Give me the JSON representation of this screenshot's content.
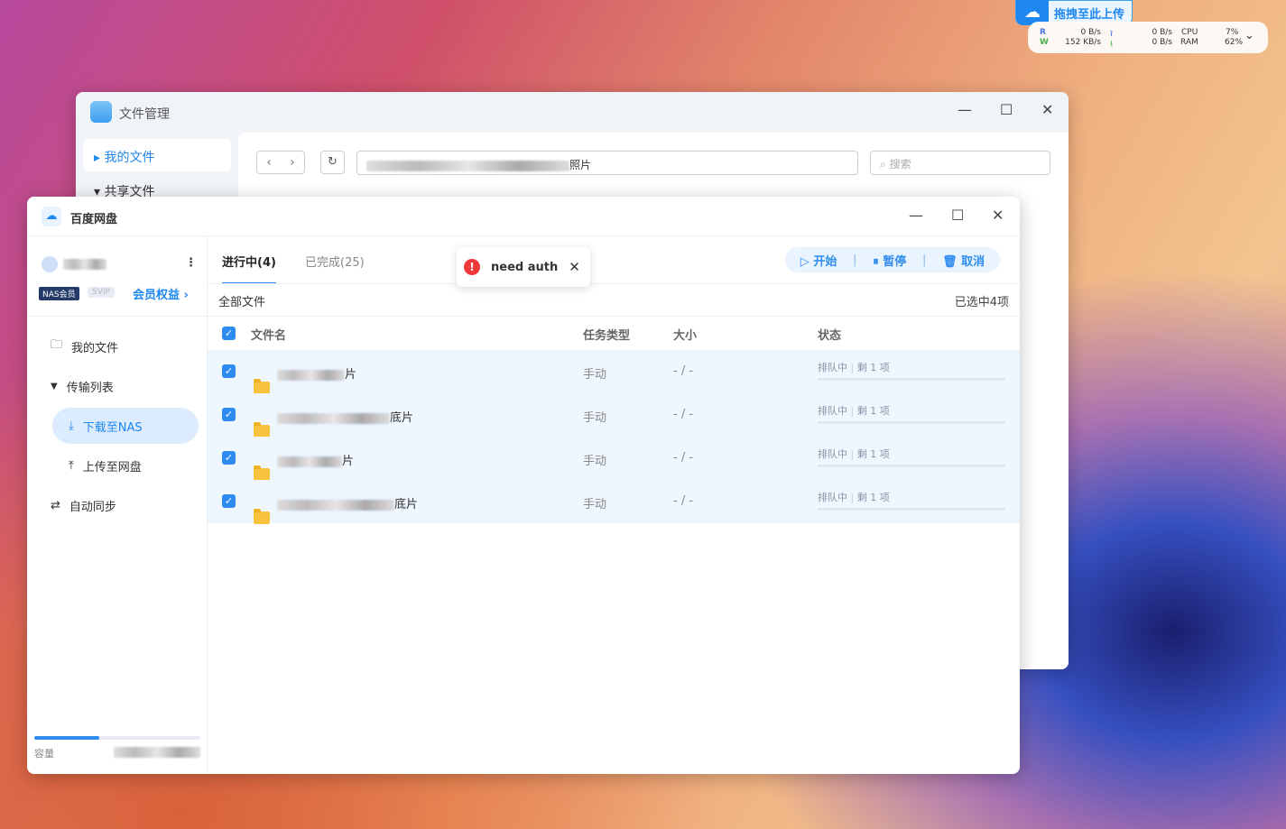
{
  "widget": {
    "upload_label": "拖拽至此上传",
    "r_label": "R",
    "w_label": "W",
    "r_speed": "0  B/s",
    "w_speed": "152 KB/s",
    "up_speed": "0  B/s",
    "down_speed": "0  B/s",
    "cpu_label": "CPU",
    "cpu_value": "7%",
    "ram_label": "RAM",
    "ram_value": "62%"
  },
  "file_manager": {
    "title": "文件管理",
    "nav": [
      "我的文件",
      "共享文件"
    ],
    "path_suffix": "照片",
    "search_placeholder": "搜索"
  },
  "baidu": {
    "title": "百度网盘",
    "badge_nas": "NAS会员",
    "badge_svip": "SVIP",
    "member_link": "会员权益 ›",
    "nav": {
      "my_files": "我的文件",
      "transfer_list": "传输列表",
      "download_nas": "下载至NAS",
      "upload_pan": "上传至网盘",
      "auto_sync": "自动同步"
    },
    "capacity_label": "容量",
    "capacity_fraction": 0.39,
    "tabs": [
      {
        "label": "进行中(4)"
      },
      {
        "label": "已完成(25)"
      }
    ],
    "actions": {
      "start": "开始",
      "pause": "暂停",
      "cancel": "取消"
    },
    "filter_label": "全部文件",
    "selected_text": "已选中4项",
    "columns": {
      "name": "文件名",
      "type": "任务类型",
      "size": "大小",
      "status": "状态"
    },
    "rows": [
      {
        "name_suffix": "片",
        "type": "手动",
        "size": "- / -",
        "status": "排队中",
        "remaining": "剩 1 项"
      },
      {
        "name_suffix": "底片",
        "type": "手动",
        "size": "- / -",
        "status": "排队中",
        "remaining": "剩 1 项"
      },
      {
        "name_suffix": "片",
        "type": "手动",
        "size": "- / -",
        "status": "排队中",
        "remaining": "剩 1 项"
      },
      {
        "name_suffix": "底片",
        "type": "手动",
        "size": "- / -",
        "status": "排队中",
        "remaining": "剩 1 项"
      }
    ]
  },
  "toast": {
    "message": "need auth"
  }
}
